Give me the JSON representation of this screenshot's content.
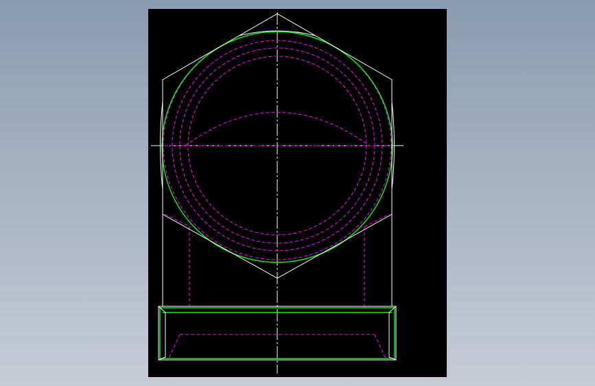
{
  "background": {
    "top_color": "#8a9cb1",
    "bottom_color": "#c6ccd6"
  },
  "viewport": {
    "background_color": "#000000"
  },
  "drawing": {
    "visible_line_color": "#ffffff",
    "hidden_line_color": "#ff00ff",
    "thread_line_color": "#00ff00",
    "centerline_color": "#ffffff"
  }
}
